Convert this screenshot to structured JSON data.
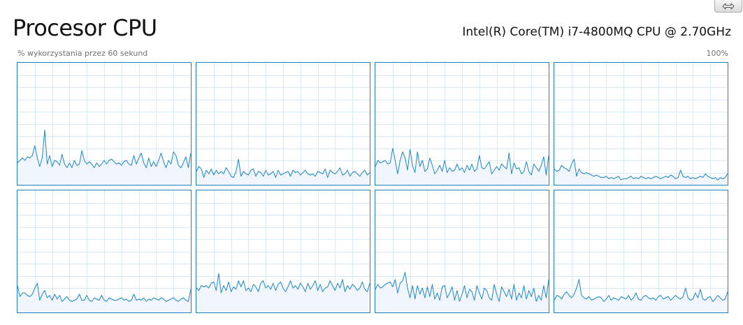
{
  "header": {
    "title": "Procesor CPU",
    "cpu_model": "Intel(R) Core(TM) i7-4800MQ CPU @ 2.70GHz",
    "subtitle_left": "% wykorzystania przez 60 sekund",
    "subtitle_right": "100%"
  },
  "toolbar": {
    "swap_icon": "swap-arrows-icon"
  },
  "colors": {
    "accent": "#1c7fbc",
    "line": "#1e86c8",
    "fill": "#eef5fb",
    "grid": "#d9eaf7"
  },
  "chart_data": [
    {
      "type": "area",
      "name": "core-1",
      "ylim": [
        0,
        100
      ],
      "values": [
        18,
        20,
        22,
        20,
        23,
        22,
        24,
        32,
        22,
        15,
        22,
        45,
        17,
        24,
        15,
        20,
        19,
        16,
        25,
        17,
        14,
        18,
        14,
        20,
        16,
        17,
        28,
        20,
        17,
        19,
        17,
        14,
        18,
        15,
        17,
        20,
        17,
        20,
        21,
        19,
        17,
        18,
        16,
        19,
        20,
        17,
        16,
        24,
        17,
        22,
        26,
        18,
        14,
        22,
        15,
        19,
        15,
        20,
        26,
        19,
        14,
        20,
        17,
        27,
        24,
        16,
        14,
        18,
        23,
        14,
        26
      ]
    },
    {
      "type": "area",
      "name": "core-2",
      "ylim": [
        0,
        100
      ],
      "values": [
        11,
        15,
        13,
        6,
        12,
        9,
        13,
        8,
        12,
        9,
        11,
        9,
        14,
        11,
        7,
        6,
        11,
        21,
        7,
        11,
        9,
        8,
        12,
        13,
        7,
        11,
        10,
        7,
        12,
        8,
        9,
        11,
        6,
        12,
        8,
        9,
        10,
        11,
        7,
        12,
        10,
        11,
        8,
        10,
        12,
        9,
        8,
        9,
        7,
        11,
        10,
        9,
        13,
        6,
        12,
        10,
        9,
        11,
        14,
        8,
        9,
        12,
        7,
        10,
        11,
        9,
        7,
        10,
        12,
        8,
        10
      ]
    },
    {
      "type": "area",
      "name": "core-3",
      "ylim": [
        0,
        100
      ],
      "values": [
        15,
        20,
        18,
        19,
        20,
        17,
        18,
        30,
        20,
        9,
        20,
        27,
        22,
        12,
        29,
        16,
        10,
        27,
        15,
        20,
        11,
        13,
        22,
        16,
        9,
        12,
        16,
        11,
        20,
        10,
        14,
        11,
        12,
        17,
        12,
        14,
        10,
        16,
        12,
        17,
        11,
        13,
        24,
        14,
        13,
        16,
        19,
        9,
        12,
        15,
        12,
        17,
        15,
        13,
        26,
        9,
        18,
        13,
        14,
        9,
        11,
        19,
        11,
        8,
        17,
        14,
        11,
        16,
        23,
        8,
        24
      ]
    },
    {
      "type": "area",
      "name": "core-4",
      "ylim": [
        0,
        100
      ],
      "values": [
        13,
        11,
        12,
        16,
        14,
        13,
        11,
        17,
        21,
        7,
        13,
        10,
        9,
        10,
        9,
        8,
        7,
        8,
        7,
        6,
        6,
        7,
        5,
        6,
        5,
        6,
        7,
        4,
        5,
        5,
        6,
        7,
        5,
        6,
        5,
        7,
        6,
        5,
        6,
        5,
        6,
        7,
        6,
        5,
        6,
        7,
        6,
        8,
        7,
        5,
        6,
        12,
        7,
        6,
        7,
        5,
        6,
        5,
        6,
        7,
        6,
        9,
        7,
        6,
        5,
        6,
        4,
        6,
        5,
        6,
        9
      ]
    },
    {
      "type": "area",
      "name": "core-5",
      "ylim": [
        0,
        100
      ],
      "values": [
        22,
        13,
        16,
        16,
        14,
        13,
        15,
        20,
        24,
        10,
        15,
        18,
        12,
        14,
        10,
        15,
        11,
        14,
        9,
        11,
        13,
        10,
        9,
        10,
        11,
        15,
        10,
        10,
        14,
        10,
        9,
        12,
        11,
        10,
        14,
        10,
        9,
        12,
        11,
        10,
        10,
        11,
        12,
        10,
        11,
        9,
        10,
        15,
        10,
        11,
        10,
        12,
        9,
        11,
        10,
        12,
        11,
        10,
        12,
        11,
        9,
        10,
        11,
        12,
        10,
        9,
        11,
        12,
        10,
        9,
        19
      ]
    },
    {
      "type": "area",
      "name": "core-6",
      "ylim": [
        0,
        100
      ],
      "values": [
        20,
        18,
        22,
        21,
        22,
        20,
        24,
        25,
        18,
        32,
        16,
        22,
        18,
        25,
        17,
        21,
        19,
        26,
        21,
        26,
        18,
        20,
        17,
        23,
        21,
        17,
        24,
        26,
        20,
        22,
        19,
        24,
        18,
        23,
        25,
        20,
        17,
        21,
        26,
        20,
        22,
        19,
        24,
        21,
        17,
        24,
        19,
        22,
        26,
        18,
        23,
        17,
        20,
        21,
        26,
        22,
        18,
        24,
        20,
        27,
        17,
        22,
        19,
        23,
        21,
        18,
        20,
        25,
        19,
        17,
        24
      ]
    },
    {
      "type": "area",
      "name": "core-7",
      "ylim": [
        0,
        100
      ],
      "values": [
        19,
        23,
        20,
        21,
        23,
        24,
        25,
        21,
        27,
        16,
        24,
        26,
        33,
        20,
        12,
        22,
        11,
        22,
        15,
        20,
        12,
        21,
        13,
        23,
        11,
        16,
        10,
        21,
        22,
        12,
        16,
        21,
        10,
        18,
        9,
        15,
        22,
        12,
        19,
        17,
        10,
        22,
        16,
        11,
        20,
        18,
        12,
        10,
        23,
        15,
        9,
        21,
        17,
        13,
        19,
        11,
        23,
        10,
        16,
        12,
        22,
        11,
        18,
        13,
        20,
        9,
        14,
        10,
        22,
        12,
        27
      ]
    },
    {
      "type": "area",
      "name": "core-8",
      "ylim": [
        0,
        100
      ],
      "values": [
        10,
        14,
        13,
        11,
        15,
        17,
        14,
        12,
        15,
        20,
        27,
        14,
        12,
        11,
        13,
        10,
        11,
        12,
        13,
        12,
        9,
        11,
        14,
        10,
        12,
        11,
        10,
        13,
        12,
        11,
        14,
        10,
        12,
        16,
        11,
        10,
        13,
        14,
        12,
        11,
        12,
        10,
        13,
        14,
        11,
        12,
        13,
        10,
        12,
        14,
        12,
        11,
        13,
        20,
        12,
        10,
        11,
        16,
        12,
        19,
        11,
        10,
        12,
        13,
        9,
        11,
        14,
        12,
        10,
        11,
        17
      ]
    }
  ]
}
